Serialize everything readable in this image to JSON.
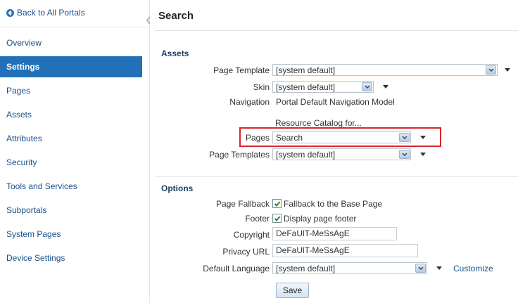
{
  "sidebar": {
    "back_label": "Back to All Portals",
    "items": [
      {
        "label": "Overview",
        "active": false
      },
      {
        "label": "Settings",
        "active": true
      },
      {
        "label": "Pages",
        "active": false
      },
      {
        "label": "Assets",
        "active": false
      },
      {
        "label": "Attributes",
        "active": false
      },
      {
        "label": "Security",
        "active": false
      },
      {
        "label": "Tools and Services",
        "active": false
      },
      {
        "label": "Subportals",
        "active": false
      },
      {
        "label": "System Pages",
        "active": false
      },
      {
        "label": "Device Settings",
        "active": false
      }
    ]
  },
  "main": {
    "title": "Search",
    "assets": {
      "heading": "Assets",
      "page_template_label": "Page Template",
      "page_template_value": "[system default]",
      "skin_label": "Skin",
      "skin_value": "[system default]",
      "navigation_label": "Navigation",
      "navigation_value": "Portal Default Navigation Model",
      "resource_catalog_heading": "Resource Catalog for...",
      "pages_label": "Pages",
      "pages_value": "Search",
      "page_templates_label": "Page Templates",
      "page_templates_value": "[system default]"
    },
    "options": {
      "heading": "Options",
      "page_fallback_label": "Page Fallback",
      "page_fallback_text": "Fallback to the Base Page",
      "page_fallback_checked": true,
      "footer_label": "Footer",
      "footer_text": "Display page footer",
      "footer_checked": true,
      "copyright_label": "Copyright",
      "copyright_value": "DeFaUlT-MeSsAgE",
      "privacy_url_label": "Privacy URL",
      "privacy_url_value": "DeFaUlT-MeSsAgE",
      "default_language_label": "Default Language",
      "default_language_value": "[system default]",
      "customize_link": "Customize"
    },
    "save_label": "Save"
  },
  "colors": {
    "sidebar_active_bg": "#2170b8",
    "link": "#1a4e8a",
    "highlight_border": "#d9262b",
    "section_heading": "#1b3c5e"
  },
  "icons": {
    "back": "back-arrow-circle-icon",
    "collapse": "chevron-left-icon",
    "dropdown": "chevron-down-icon",
    "checkbox": "checkmark-icon"
  }
}
